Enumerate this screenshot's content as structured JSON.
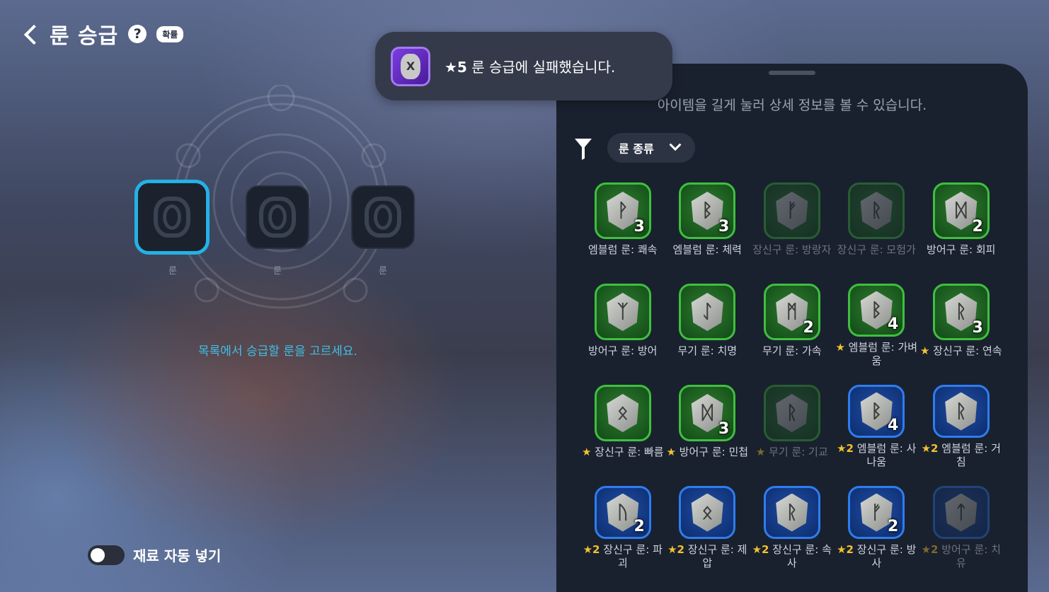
{
  "header": {
    "title": "룬 승급",
    "help_icon": "?",
    "probability_badge": "확률"
  },
  "toast": {
    "icon": "rune-x-icon",
    "star_text": "★5",
    "message": " 룬 승급에 실패했습니다."
  },
  "slots": [
    {
      "label": "룬",
      "selected": true
    },
    {
      "label": "룬",
      "selected": false
    },
    {
      "label": "룬",
      "selected": false
    }
  ],
  "choose_hint": "목록에서 승급할 룬을 고르세요.",
  "auto_fill": {
    "label": "재료 자동 넣기",
    "enabled": false
  },
  "panel": {
    "hint": "아이템을 길게 눌러 상세 정보를 볼 수 있습니다.",
    "filter_label": "룬 종류"
  },
  "runes": [
    {
      "glyph": "ᚹ",
      "color": "green",
      "count": "3",
      "star": "",
      "name": "엠블럼 룬: 쾌속",
      "dim": false
    },
    {
      "glyph": "ᛒ",
      "color": "green",
      "count": "3",
      "star": "",
      "name": "엠블럼 룬: 체력",
      "dim": false
    },
    {
      "glyph": "ᚠ",
      "color": "green",
      "count": "",
      "star": "",
      "name": "장신구 룬: 방랑자",
      "dim": true
    },
    {
      "glyph": "ᚱ",
      "color": "green",
      "count": "",
      "star": "",
      "name": "장신구 룬: 모험가",
      "dim": true
    },
    {
      "glyph": "ᛞ",
      "color": "green",
      "count": "2",
      "star": "",
      "name": "방어구 룬: 회피",
      "dim": false
    },
    {
      "glyph": "ᛉ",
      "color": "green",
      "count": "",
      "star": "",
      "name": "방어구 룬: 방어",
      "dim": false
    },
    {
      "glyph": "ᛇ",
      "color": "green",
      "count": "",
      "star": "",
      "name": "무기 룬: 치명",
      "dim": false
    },
    {
      "glyph": "ᛗ",
      "color": "green",
      "count": "2",
      "star": "",
      "name": "무기 룬: 가속",
      "dim": false
    },
    {
      "glyph": "ᛒ",
      "color": "green",
      "count": "4",
      "star": "★",
      "name": "엠블럼 룬: 가벼움",
      "dim": false
    },
    {
      "glyph": "ᚱ",
      "color": "green",
      "count": "3",
      "star": "★",
      "name": "장신구 룬: 연속",
      "dim": false
    },
    {
      "glyph": "ᛟ",
      "color": "green",
      "count": "",
      "star": "★",
      "name": "장신구 룬: 빠름",
      "dim": false
    },
    {
      "glyph": "ᛞ",
      "color": "green",
      "count": "3",
      "star": "★",
      "name": "방어구 룬: 민첩",
      "dim": false
    },
    {
      "glyph": "ᚱ",
      "color": "green",
      "count": "",
      "star": "★",
      "name": "무기 룬: 기교",
      "dim": true
    },
    {
      "glyph": "ᛒ",
      "color": "blue",
      "count": "4",
      "star": "★2",
      "name": "엠블럼 룬: 사나움",
      "dim": false
    },
    {
      "glyph": "ᚱ",
      "color": "blue",
      "count": "",
      "star": "★2",
      "name": "엠블럼 룬: 거침",
      "dim": false
    },
    {
      "glyph": "ᚢ",
      "color": "blue",
      "count": "2",
      "star": "★2",
      "name": "장신구 룬: 파괴",
      "dim": false
    },
    {
      "glyph": "ᛟ",
      "color": "blue",
      "count": "",
      "star": "★2",
      "name": "장신구 룬: 제압",
      "dim": false
    },
    {
      "glyph": "ᚱ",
      "color": "blue",
      "count": "",
      "star": "★2",
      "name": "장신구 룬: 속사",
      "dim": false
    },
    {
      "glyph": "ᚠ",
      "color": "blue",
      "count": "2",
      "star": "★2",
      "name": "장신구 룬: 방사",
      "dim": false
    },
    {
      "glyph": "ᛏ",
      "color": "blue",
      "count": "",
      "star": "★2",
      "name": "방어구 룬: 치유",
      "dim": true
    }
  ]
}
